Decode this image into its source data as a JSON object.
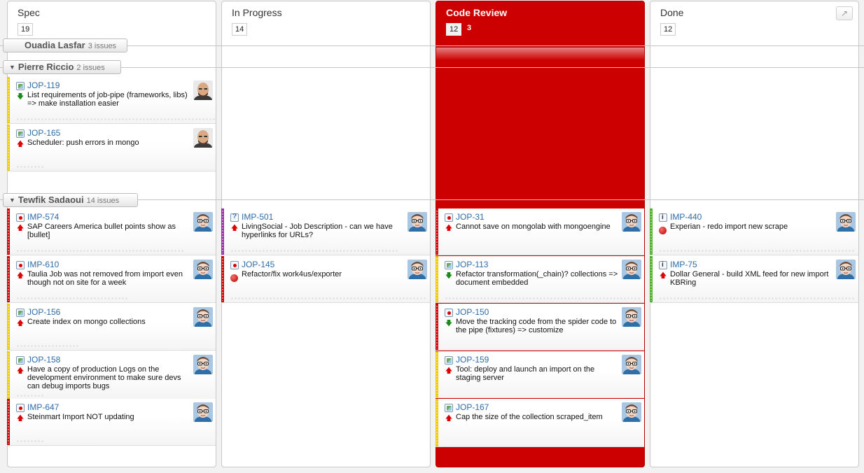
{
  "columns": [
    {
      "title": "Spec",
      "count": "19"
    },
    {
      "title": "In Progress",
      "count": "14"
    },
    {
      "title": "Code Review",
      "count": "12",
      "count_secondary": "3"
    },
    {
      "title": "Done",
      "count": "12"
    }
  ],
  "expand_icon": "expand-arrow-icon",
  "swimlanes": [
    {
      "name": "Ouadia Lasfar",
      "count": "3 issues"
    },
    {
      "name": "Pierre Riccio",
      "count": "2 issues"
    },
    {
      "name": "Tewfik Sadaoui",
      "count": "14 issues"
    }
  ],
  "colors": {
    "code_review": "#cc0000",
    "link": "#2f6ca8",
    "priority_yellow": "#f0c800",
    "priority_red": "#cc0000",
    "priority_purple": "#9b2aa6",
    "priority_green": "#4caf27"
  },
  "cards": [
    {
      "key": "JOP-119",
      "summary": "List requirements of job-pipe (frameworks, libs) => make installation easier",
      "type": "story",
      "priority": "down",
      "avatar": "bald-user-avatar"
    },
    {
      "key": "JOP-165",
      "summary": "Scheduler: push errors in mongo",
      "type": "story",
      "priority": "up",
      "avatar": "bald-user-avatar"
    },
    {
      "key": "IMP-574",
      "summary": "SAP Careers America bullet points show as [bullet]",
      "type": "bug",
      "priority": "up",
      "avatar": "glasses-user-avatar"
    },
    {
      "key": "IMP-610",
      "summary": "Taulia Job was not removed from import even though not on site for a week",
      "type": "bug",
      "priority": "up",
      "avatar": "glasses-user-avatar"
    },
    {
      "key": "JOP-156",
      "summary": "Create index on mongo collections",
      "type": "story",
      "priority": "up",
      "avatar": "glasses-user-avatar"
    },
    {
      "key": "JOP-158",
      "summary": "Have a copy of production Logs on the development environment to make sure devs can debug imports bugs",
      "type": "story",
      "priority": "up",
      "avatar": "glasses-user-avatar"
    },
    {
      "key": "IMP-647",
      "summary": "Steinmart Import NOT updating",
      "type": "bug",
      "priority": "up",
      "avatar": "glasses-user-avatar"
    },
    {
      "key": "IMP-501",
      "summary": "LivingSocial - Job Description - can we have hyperlinks for URLs?",
      "type": "question",
      "priority": "up",
      "avatar": "glasses-user-avatar"
    },
    {
      "key": "JOP-145",
      "summary": "Refactor/fix work4us/exporter",
      "type": "bug",
      "priority": "blocker",
      "avatar": "glasses-user-avatar"
    },
    {
      "key": "JOP-31",
      "summary": "Cannot save on mongolab with mongoengine",
      "type": "bug",
      "priority": "up",
      "avatar": "glasses-user-avatar"
    },
    {
      "key": "JOP-113",
      "summary": "Refactor transformation(_chain)? collections => document embedded",
      "type": "story",
      "priority": "down",
      "avatar": "glasses-user-avatar"
    },
    {
      "key": "JOP-150",
      "summary": "Move the tracking code from the spider code to the pipe (fixtures) => customize",
      "type": "bug",
      "priority": "down",
      "avatar": "glasses-user-avatar"
    },
    {
      "key": "JOP-159",
      "summary": "Tool: deploy and launch an import on the staging server",
      "type": "story",
      "priority": "up",
      "avatar": "glasses-user-avatar"
    },
    {
      "key": "JOP-167",
      "summary": "Cap the size of the collection scraped_item",
      "type": "story",
      "priority": "up",
      "avatar": "glasses-user-avatar"
    },
    {
      "key": "IMP-440",
      "summary": "Experian - redo import new scrape",
      "type": "info",
      "priority": "blocker",
      "avatar": "glasses-user-avatar"
    },
    {
      "key": "IMP-75",
      "summary": "Dollar General - build XML feed for new import KBRing",
      "type": "info",
      "priority": "up",
      "avatar": "glasses-user-avatar"
    }
  ]
}
